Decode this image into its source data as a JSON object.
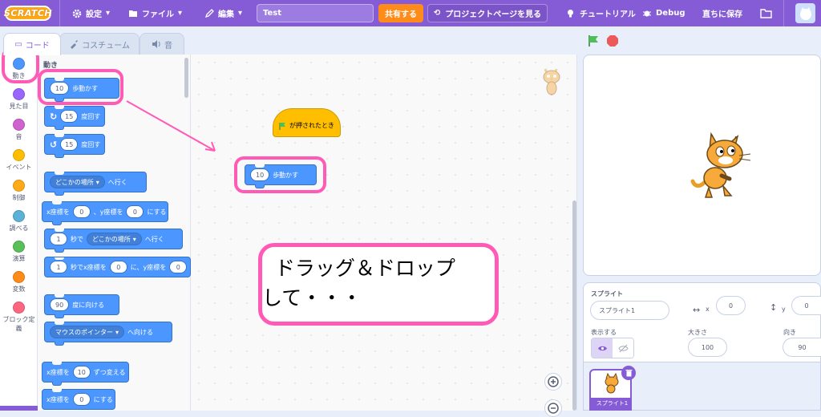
{
  "menubar": {
    "logo": "SCRATCH",
    "settings": "設定",
    "file": "ファイル",
    "edit": "編集",
    "project_title": "Test",
    "share": "共有する",
    "project_page": "プロジェクトページを見る",
    "tutorials": "チュートリアル",
    "debug": "Debug",
    "save_now": "直ちに保存"
  },
  "tabs": {
    "code": "コード",
    "costumes": "コスチューム",
    "sounds": "音"
  },
  "categories": [
    {
      "label": "動き",
      "color": "#4c97ff"
    },
    {
      "label": "見た目",
      "color": "#9966ff"
    },
    {
      "label": "音",
      "color": "#cf63cf"
    },
    {
      "label": "イベント",
      "color": "#ffbf00"
    },
    {
      "label": "制御",
      "color": "#ffab19"
    },
    {
      "label": "調べる",
      "color": "#5cb1d6"
    },
    {
      "label": "演算",
      "color": "#59c059"
    },
    {
      "label": "変数",
      "color": "#ff8c1a"
    },
    {
      "label": "ブロック定",
      "label2": "義",
      "color": "#ff6680"
    }
  ],
  "palette": {
    "section": "動き",
    "move": {
      "value": "10",
      "text": "歩動かす"
    },
    "turn_right": {
      "value": "15",
      "text": "度回す"
    },
    "turn_left": {
      "value": "15",
      "text": "度回す"
    },
    "goto": {
      "menu": "どこかの場所",
      "text": "へ行く"
    },
    "goto_xy": {
      "x_label": "x座標を",
      "x": "0",
      "sep": "、y座標を",
      "y": "0",
      "text": "にする"
    },
    "glide": {
      "value": "1",
      "mid": "秒で",
      "menu": "どこかの場所",
      "text": "へ行く"
    },
    "glide_xy": {
      "value": "1",
      "mid": "秒でx座標を",
      "x": "0",
      "sep": "に、y座標を",
      "y": "0"
    },
    "point_dir": {
      "value": "90",
      "text": "度に向ける"
    },
    "point_towards": {
      "menu": "マウスのポインター",
      "text": "へ向ける"
    },
    "change_x": {
      "label": "x座標を",
      "value": "10",
      "text": "ずつ変える"
    },
    "set_x": {
      "label": "x座標を",
      "value": "0",
      "text": "にする"
    }
  },
  "workspace": {
    "hat_text": "が押されたとき",
    "dropped_block": {
      "value": "10",
      "text": "歩動かす"
    },
    "annotation_line1": "  ドラッグ＆ドロップ",
    "annotation_line2": "して・・・"
  },
  "sprite_info": {
    "sprite_label": "スプライト",
    "sprite_name": "スプライト1",
    "x_label": "x",
    "x_value": "0",
    "y_label": "y",
    "y_value": "0",
    "show_label": "表示する",
    "size_label": "大きさ",
    "size_value": "100",
    "direction_label": "向き",
    "direction_value": "90",
    "thumb_name": "スプライト1"
  },
  "colors": {
    "menubar": "#855cd6",
    "motion": "#4c97ff",
    "highlight": "#ff5bb6",
    "share": "#ff8c1a"
  }
}
